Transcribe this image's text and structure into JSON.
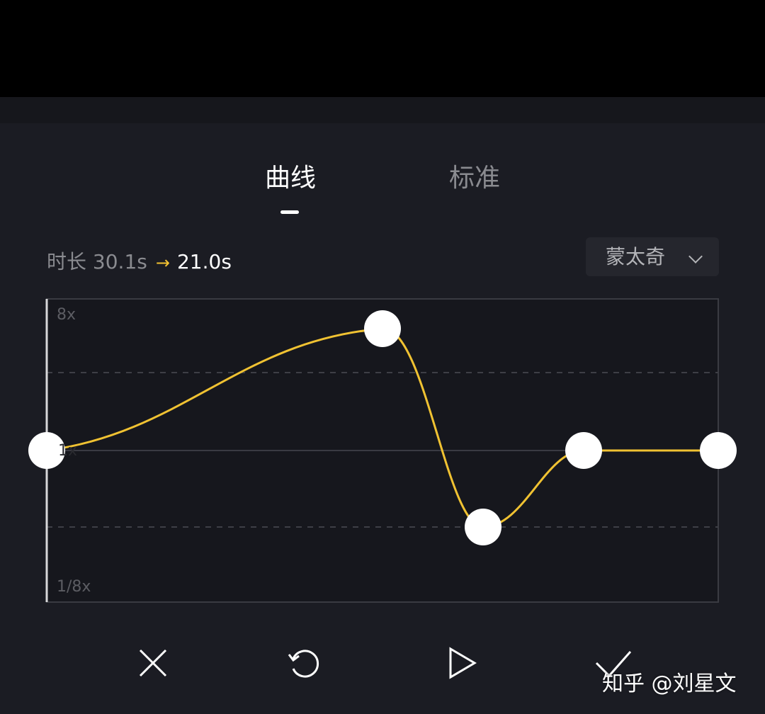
{
  "tabs": [
    {
      "label": "曲线",
      "active": true
    },
    {
      "label": "标准",
      "active": false
    }
  ],
  "duration": {
    "label": "时长",
    "original": "30.1s",
    "new": "21.0s"
  },
  "preset": {
    "label": "蒙太奇"
  },
  "curve": {
    "axis_top": "8x",
    "axis_mid": "1x",
    "axis_bottom": "1/8x",
    "colors": {
      "curve": "#f0c232",
      "grid": "#3a3b42"
    },
    "points": [
      {
        "t": 0.0,
        "speed_level": 0.5
      },
      {
        "t": 0.5,
        "speed_level": 0.9
      },
      {
        "t": 0.65,
        "speed_level": 0.25
      },
      {
        "t": 0.8,
        "speed_level": 0.5
      },
      {
        "t": 1.0,
        "speed_level": 0.5
      }
    ]
  },
  "controls": [
    "close-icon",
    "reset-icon",
    "play-icon",
    "confirm-icon"
  ],
  "watermark": "知乎 @刘星文"
}
